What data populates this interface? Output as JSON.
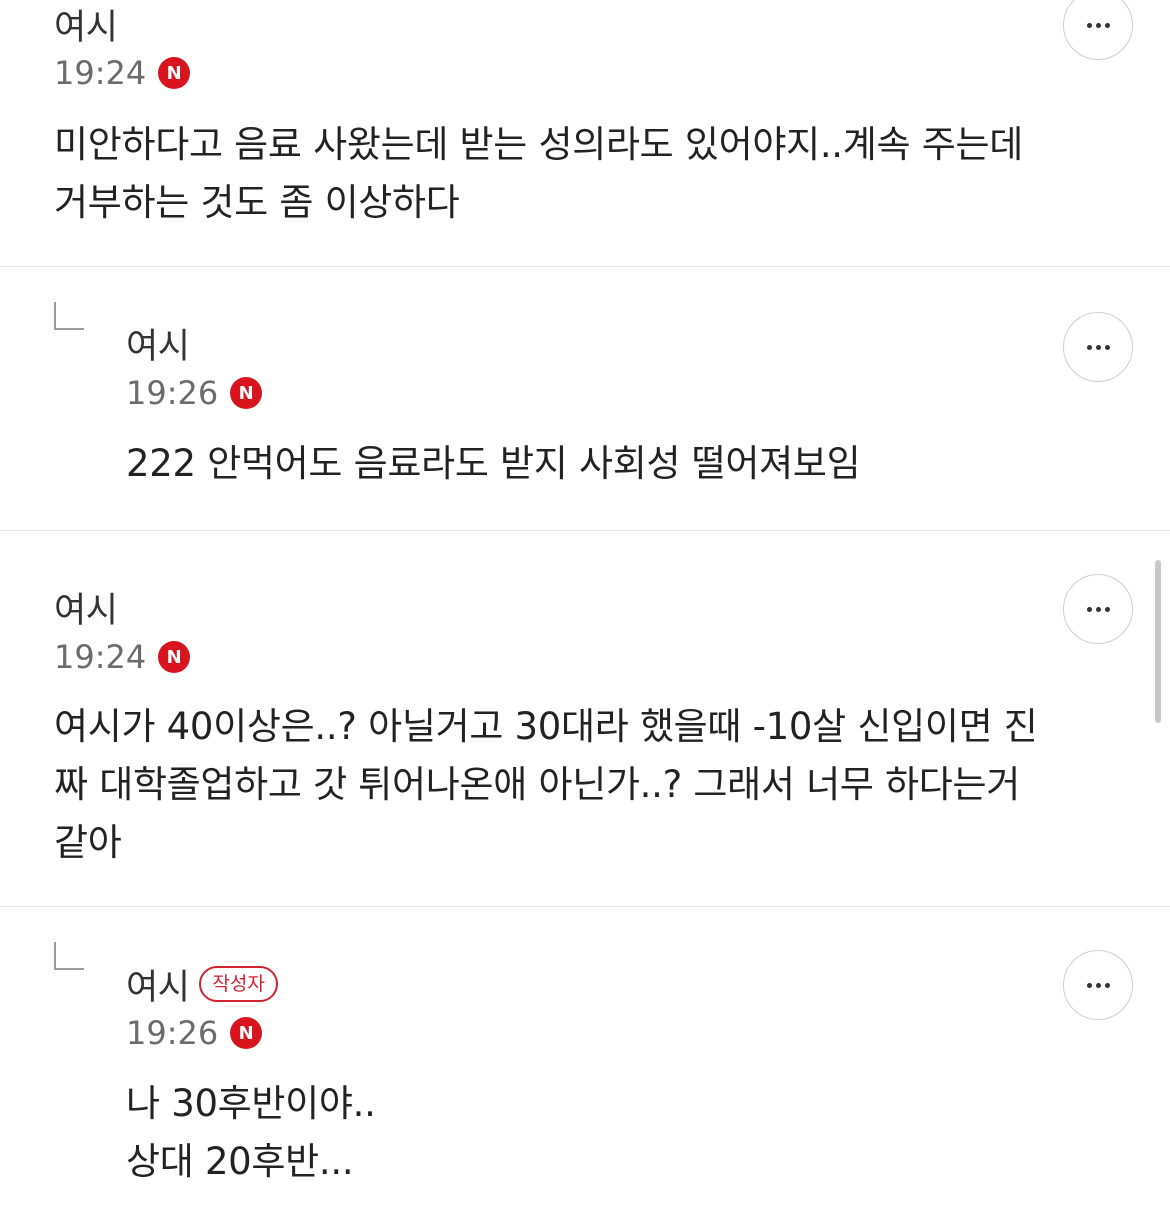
{
  "comments": [
    {
      "author": "여시",
      "time": "19:24",
      "new_badge": "N",
      "text": "미안하다고 음료 사왔는데 받는 성의라도 있어야지..계속 주는데\n거부하는 것도 좀 이상하다",
      "is_reply": false,
      "is_writer": false
    },
    {
      "author": "여시",
      "time": "19:26",
      "new_badge": "N",
      "text": "222 안먹어도 음료라도 받지 사회성 떨어져보임",
      "is_reply": true,
      "is_writer": false
    },
    {
      "author": "여시",
      "time": "19:24",
      "new_badge": "N",
      "text": "여시가 40이상은..? 아닐거고 30대라 했을때 -10살 신입이면 진\n짜 대학졸업하고 갓 튀어나온애 아닌가..? 그래서 너무 하다는거\n같아",
      "is_reply": false,
      "is_writer": false
    },
    {
      "author": "여시",
      "writer_badge": "작성자",
      "time": "19:26",
      "new_badge": "N",
      "text": "나 30후반이야..\n상대 20후반...",
      "is_reply": true,
      "is_writer": true
    }
  ],
  "icons": {
    "more": "more-horizontal-icon",
    "reply": "reply-corner-icon",
    "new": "new-badge-icon"
  },
  "colors": {
    "accent": "#d8141e",
    "writer_badge": "#d2222d",
    "divider": "#e3e3e3",
    "time": "#6b6b6b"
  }
}
